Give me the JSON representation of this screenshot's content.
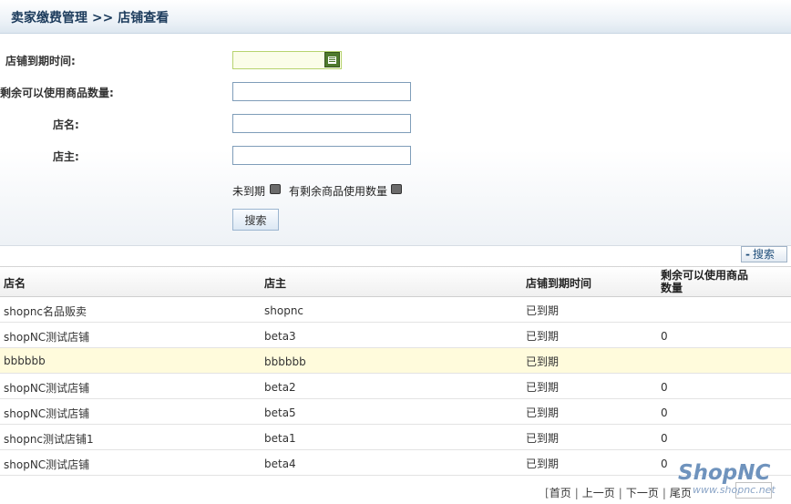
{
  "header": {
    "title": "卖家缴费管理 >> 店铺查看"
  },
  "form": {
    "expiry_label": "店铺到期时间:",
    "expiry_value": "",
    "remaining_label": "剩余可以使用商品数量:",
    "remaining_value": "",
    "shop_name_label": "店名:",
    "shop_name_value": "",
    "owner_label": "店主:",
    "owner_value": "",
    "not_expired_label": "未到期",
    "has_remaining_label": "有剩余商品使用数量",
    "search_label": "搜索"
  },
  "toolbar": {
    "toggle_label": "搜索",
    "toggle_symbol": "-"
  },
  "table": {
    "headers": [
      "店名",
      "店主",
      "店铺到期时间",
      "剩余可以使用商品数量"
    ],
    "rows": [
      {
        "name": "shopnc名品贩卖",
        "owner": "shopnc",
        "expiry": "已到期",
        "remaining": ""
      },
      {
        "name": "shopNC测试店铺",
        "owner": "beta3",
        "expiry": "已到期",
        "remaining": "0"
      },
      {
        "name": "bbbbbb",
        "owner": "bbbbbb",
        "expiry": "已到期",
        "remaining": ""
      },
      {
        "name": "shopNC测试店铺",
        "owner": "beta2",
        "expiry": "已到期",
        "remaining": "0"
      },
      {
        "name": "shopNC测试店铺",
        "owner": "beta5",
        "expiry": "已到期",
        "remaining": "0"
      },
      {
        "name": "shopnc测试店铺1",
        "owner": "beta1",
        "expiry": "已到期",
        "remaining": "0"
      },
      {
        "name": "shopNC测试店铺",
        "owner": "beta4",
        "expiry": "已到期",
        "remaining": "0"
      }
    ]
  },
  "pager": {
    "first": "首页",
    "prev": "上一页",
    "next": "下一页",
    "last": "尾页"
  },
  "watermark": {
    "logo": "ShopNC",
    "site": "www.shopnc.net"
  },
  "colors": {
    "highlight_row": "#fffbdc",
    "accent": "#1c3b5c"
  }
}
